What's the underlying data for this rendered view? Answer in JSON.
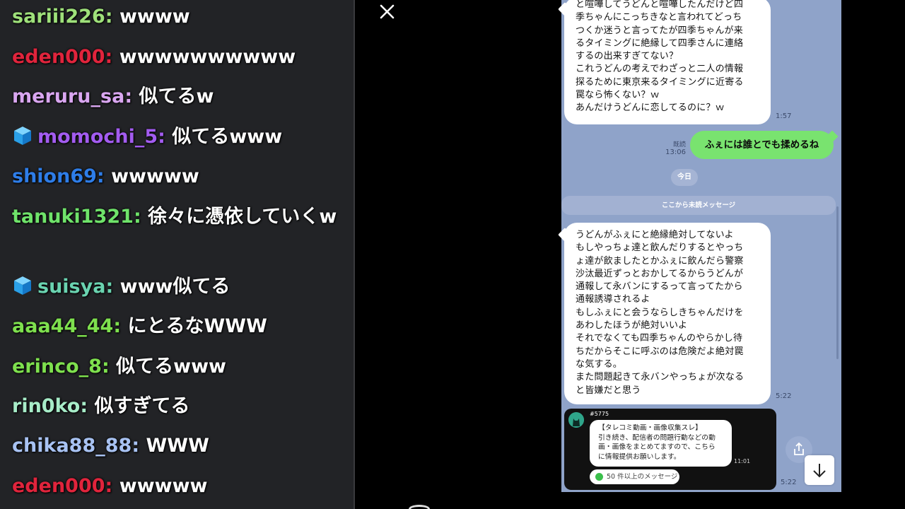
{
  "chat": {
    "messages": [
      {
        "user": "sariii226",
        "color": "#9ee07a",
        "text": "wwww",
        "badge": false
      },
      {
        "user": "eden000",
        "color": "#e0243c",
        "text": "wwwwwwwwww",
        "badge": false
      },
      {
        "user": "meruru_sa",
        "color": "#d9a6f0",
        "text": "似てるw",
        "badge": false
      },
      {
        "user": "momochi_5",
        "color": "#a35cf0",
        "text": "似てるwww",
        "badge": true
      },
      {
        "user": "shion69",
        "color": "#2e7de8",
        "text": "wwwww",
        "badge": false
      },
      {
        "user": "tanuki1321",
        "color": "#6fe36a",
        "text": "徐々に憑依していくw",
        "badge": false
      },
      {
        "user": "suisya",
        "color": "#6ad3b0",
        "text": "www似てる",
        "badge": true
      },
      {
        "user": "aaa44_44",
        "color": "#7ee04e",
        "text": "にとるなWWW",
        "badge": false
      },
      {
        "user": "erinco_8",
        "color": "#7ee04e",
        "text": "似てるwww",
        "badge": false
      },
      {
        "user": "rin0ko",
        "color": "#a7ecc8",
        "text": "似すぎてる",
        "badge": false
      },
      {
        "user": "chika88_88",
        "color": "#a8c2f2",
        "text": "WWW",
        "badge": false
      },
      {
        "user": "eden000",
        "color": "#e0243c",
        "text": "wwwww",
        "badge": false
      }
    ]
  },
  "phone": {
    "msg1": {
      "text": "と喧嘩してうどんと喧嘩したんだけど四\n季ちゃんにこっちきなと言われてどっち\nつくか迷うと言ってたが四季ちゃんが来\nるタイミングに絶縁して四季さんに連絡\nするの出来すぎてない？\nこれうどんの考えでわざっと二人の情報\n探るために東京来るタイミングに近寄る\n罠なら怖くない？ｗ\nあんだけうどんに恋してるのに？ｗ",
      "time": "1:57"
    },
    "msg2": {
      "text": "ふぇには誰とでも揉めるね",
      "read": "既読",
      "time": "13:06"
    },
    "date_label": "今日",
    "unread_label": "ここから未読メッセージ",
    "msg3": {
      "text": "うどんがふぇにと絶縁絶対してないよ\nもしやっちょ達と飲んだりするとやっち\nょ達が飲ましたとかふぇに飲んだら警察\n沙汰最近ずっとおかしてるからうどんが\n通報して永バンにするって言ってたから\n通報誘導されるよ\nもしふぇにと会うならしきちゃんだけを\nあわしたほうが絶対いいよ\nそれでなくても四季ちゃんのやらかし待\nちだからそこに呼ぶのは危険だよ絶対罠\nな気する。\nまた問題起きて永バンやっちょが次なる\nと皆嫌だと思う",
      "time": "5:22"
    },
    "card": {
      "tag": "#5775",
      "text": "【タレコミ動画・画像収集スレ】\n引き続き、配信者の問題行動などの動\n画・画像をまとめてますので、こちら\nに情報提供お願いします。",
      "time": "11:01",
      "more": "50 件以上のメッセージ",
      "outer_time": "5:22"
    }
  },
  "icons": {
    "close": "close-icon",
    "share": "share-icon",
    "down": "arrow-down-icon",
    "badge": "cube-badge-icon"
  }
}
